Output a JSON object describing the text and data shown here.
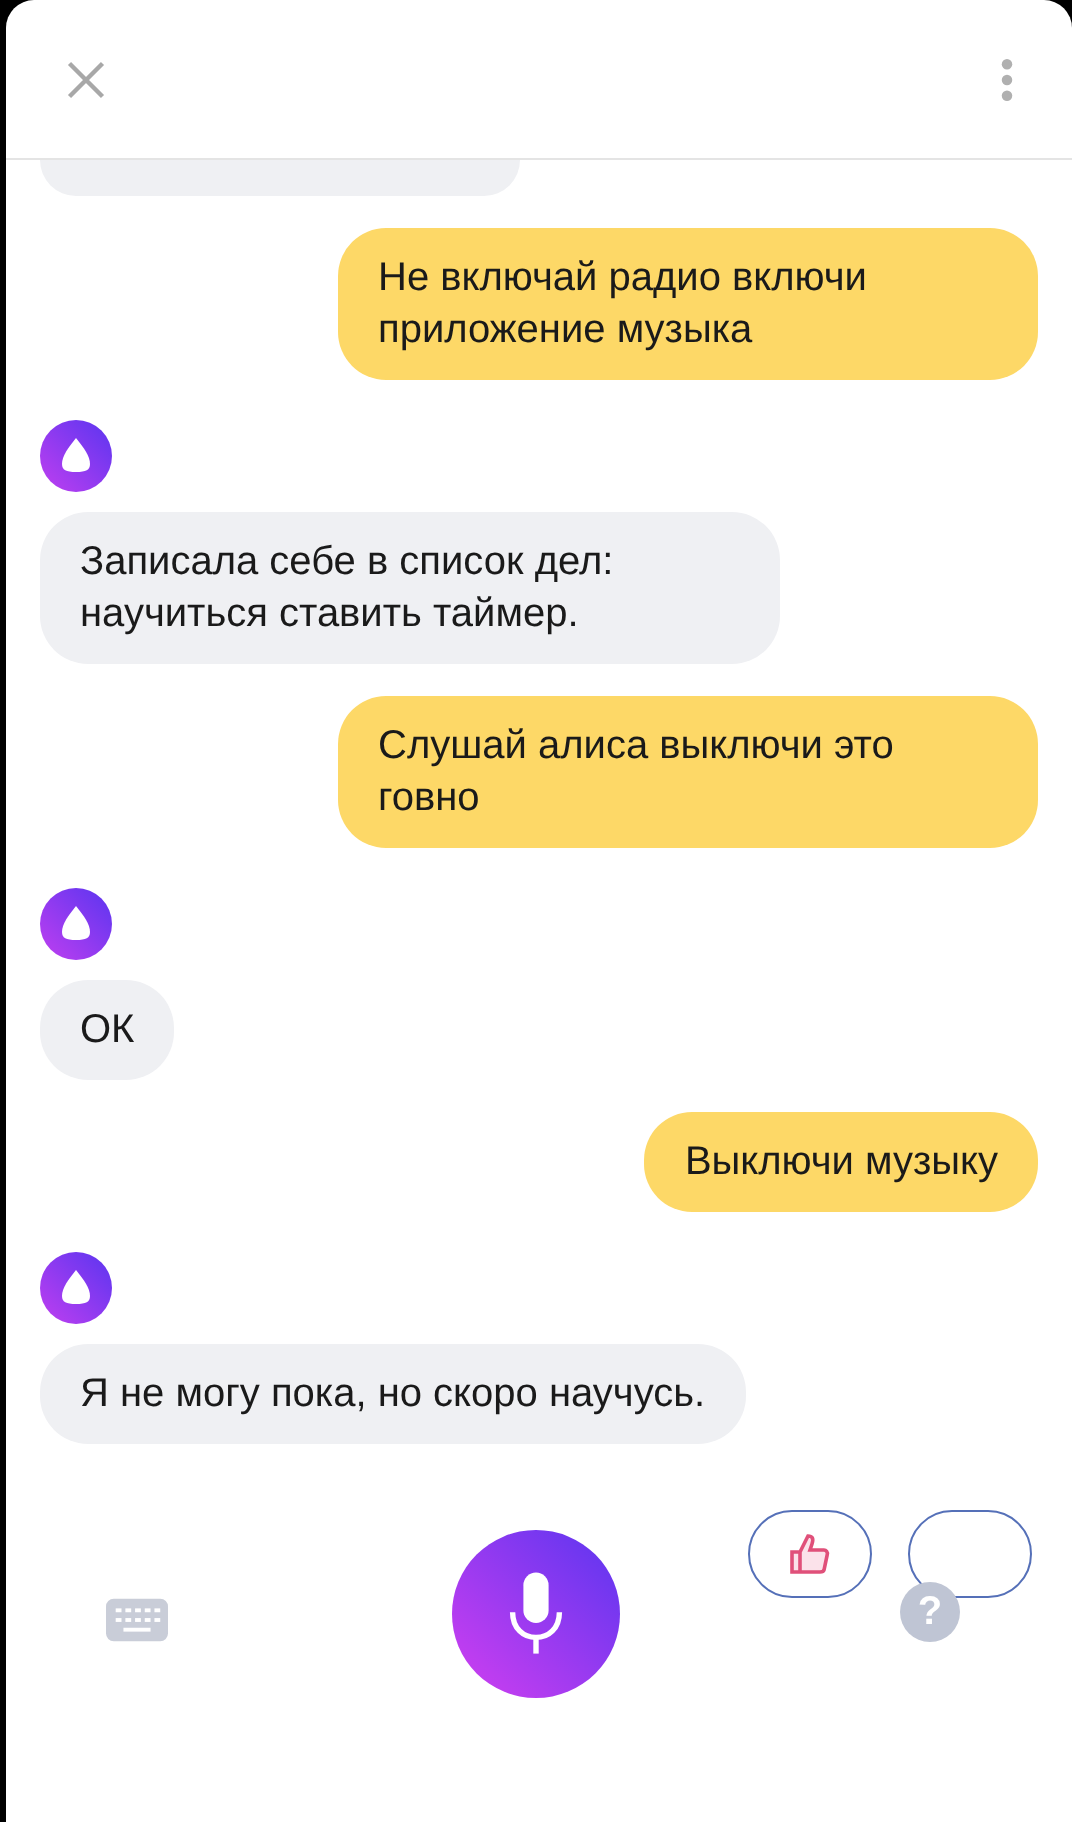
{
  "messages": [
    {
      "kind": "assistant_cut"
    },
    {
      "kind": "user",
      "text": "Не включай радио включи приложение музыка"
    },
    {
      "kind": "assistant",
      "text": "Записала себе в список дел: научиться ставить таймер."
    },
    {
      "kind": "user",
      "text": "Слушай алиса выключи это говно"
    },
    {
      "kind": "assistant",
      "text": "ОК"
    },
    {
      "kind": "user",
      "text": "Выключи музыку"
    },
    {
      "kind": "assistant",
      "text": "Я не могу пока, но скоро научусь."
    }
  ],
  "help": "?"
}
